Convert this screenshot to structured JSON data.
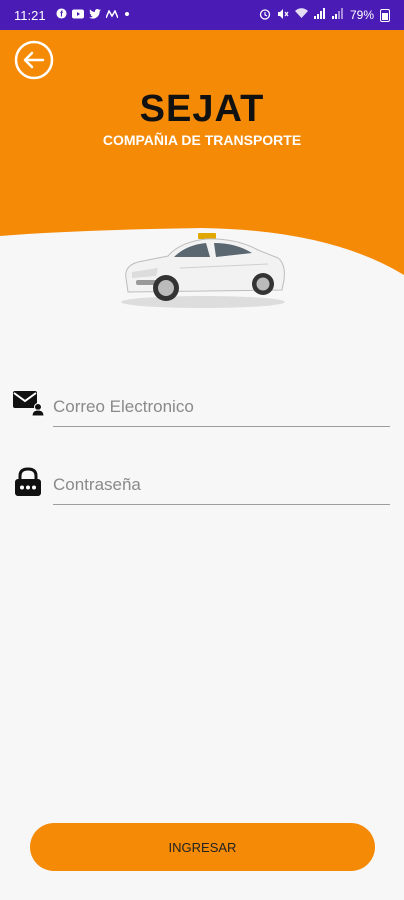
{
  "status_bar": {
    "time": "11:21",
    "notification_icons": [
      "facebook-icon",
      "youtube-icon",
      "twitter-icon",
      "m-app-icon",
      "dot"
    ],
    "battery": "79%"
  },
  "colors": {
    "accent": "#f58a07",
    "status_bar": "#4a1bb5",
    "background": "#f7f7f7"
  },
  "header": {
    "brand": "SEJAT",
    "subtitle": "COMPAÑIA DE TRANSPORTE"
  },
  "form": {
    "email": {
      "placeholder": "Correo Electronico",
      "value": "",
      "icon": "mail-user-icon"
    },
    "password": {
      "placeholder": "Contraseña",
      "value": "",
      "icon": "lock-icon"
    }
  },
  "submit": {
    "label": "INGRESAR"
  }
}
